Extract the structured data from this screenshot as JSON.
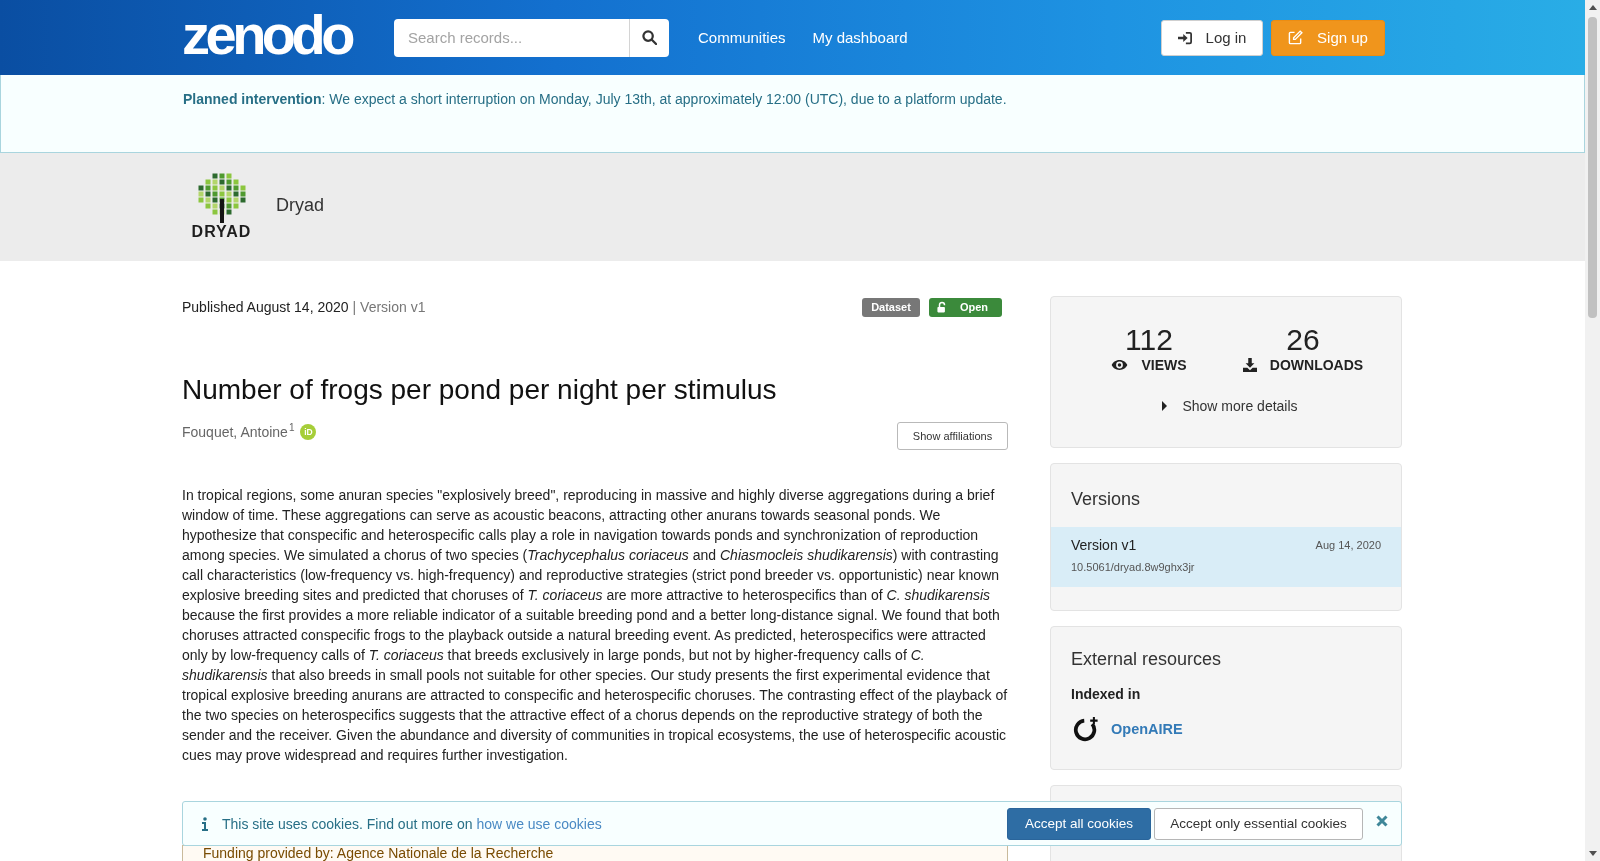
{
  "header": {
    "logo": "zenodo",
    "search": {
      "placeholder": "Search records..."
    },
    "nav": [
      "Communities",
      "My dashboard"
    ],
    "buttons": [
      {
        "kind": "login",
        "label": "Log in"
      },
      {
        "kind": "signup",
        "label": "Sign up"
      }
    ]
  },
  "announcement": "**Planned intervention**: We expect a short interruption on Monday, July 13th, at approximately 12:00 (UTC), due to a platform update.",
  "community": {
    "logo_text": "DRYAD",
    "name": "Dryad"
  },
  "record": {
    "published": "Published August 14, 2020",
    "version": "| Version v1",
    "badges": [
      {
        "kind": "type",
        "label": "Dataset"
      },
      {
        "kind": "access",
        "label": "Open"
      }
    ],
    "title": "Number of frogs per pond per night per stimulus",
    "authors": [
      {
        "name": "Fouquet, Antoine$^{1}$",
        "orcid": "iD"
      }
    ],
    "affiliations_button": "Show affiliations",
    "abstract": "In tropical regions, some anuran species \"explosively breed\", reproducing in massive and highly diverse aggregations during a brief window of time. These aggregations can serve as acoustic beacons, attracting other anurans towards seasonal ponds. We hypothesize that conspecific and heterospecific calls play a role in navigation towards ponds and synchronization of reproduction among species. We simulated a chorus of two species (*Trachycephalus coriaceus* and *Chiasmocleis shudikarensis*) with contrasting call characteristics (low-frequency vs. high-frequency) and reproductive strategies (strict pond breeder vs. opportunistic) near known explosive breeding sites and predicted that choruses of *T. coriaceus* are more attractive to heterospecifics than of *C. shudikarensis* because the first provides a more reliable indicator of a suitable breeding pond and a better long-distance signal. We found that both choruses attracted conspecific frogs to the playback outside a natural breeding event. As predicted, heterospecifics were attracted only by low-frequency calls of *T. coriaceus* that breeds exclusively in large ponds, but not by higher-frequency calls of *C. shudikarensis* that also breeds in small pools not suitable for other species. Our study presents the first experimental evidence that tropical explosive breeding anurans are attracted to conspecific and heterospecific choruses. The contrasting effect of the playback of the two species on heterospecifics suggests that the attractive effect of a chorus depends on the reproductive strategy of both the sender and the receiver. Given the abundance and diversity of communities in tropical ecosystems, the use of heterospecific acoustic cues may prove widespread and requires further investigation.",
    "funding": "Funding provided by: Agence Nationale de la Recherche"
  },
  "sidebar": {
    "stats": [
      {
        "kind": "views",
        "value": "112",
        "label": "VIEWS"
      },
      {
        "kind": "downloads",
        "value": "26",
        "label": "DOWNLOADS"
      }
    ],
    "details_toggle": {
      "label": "Show more details",
      "expanded": false
    },
    "versions": {
      "title": "Versions",
      "items": [
        {
          "label": "Version v1",
          "date": "Aug 14, 2020",
          "doi": "10.5061/dryad.8w9ghx3jr",
          "selected": true
        }
      ]
    },
    "external_resources": {
      "title": "External resources",
      "subtitle": "Indexed in",
      "links": [
        "OpenAIRE"
      ]
    }
  },
  "cookie_bar": {
    "text": "This site uses cookies. Find out more on",
    "link": "how we use cookies",
    "buttons": [
      {
        "kind": "primary",
        "label": "Accept all cookies"
      },
      {
        "kind": "default",
        "label": "Accept only essential cookies"
      }
    ]
  }
}
